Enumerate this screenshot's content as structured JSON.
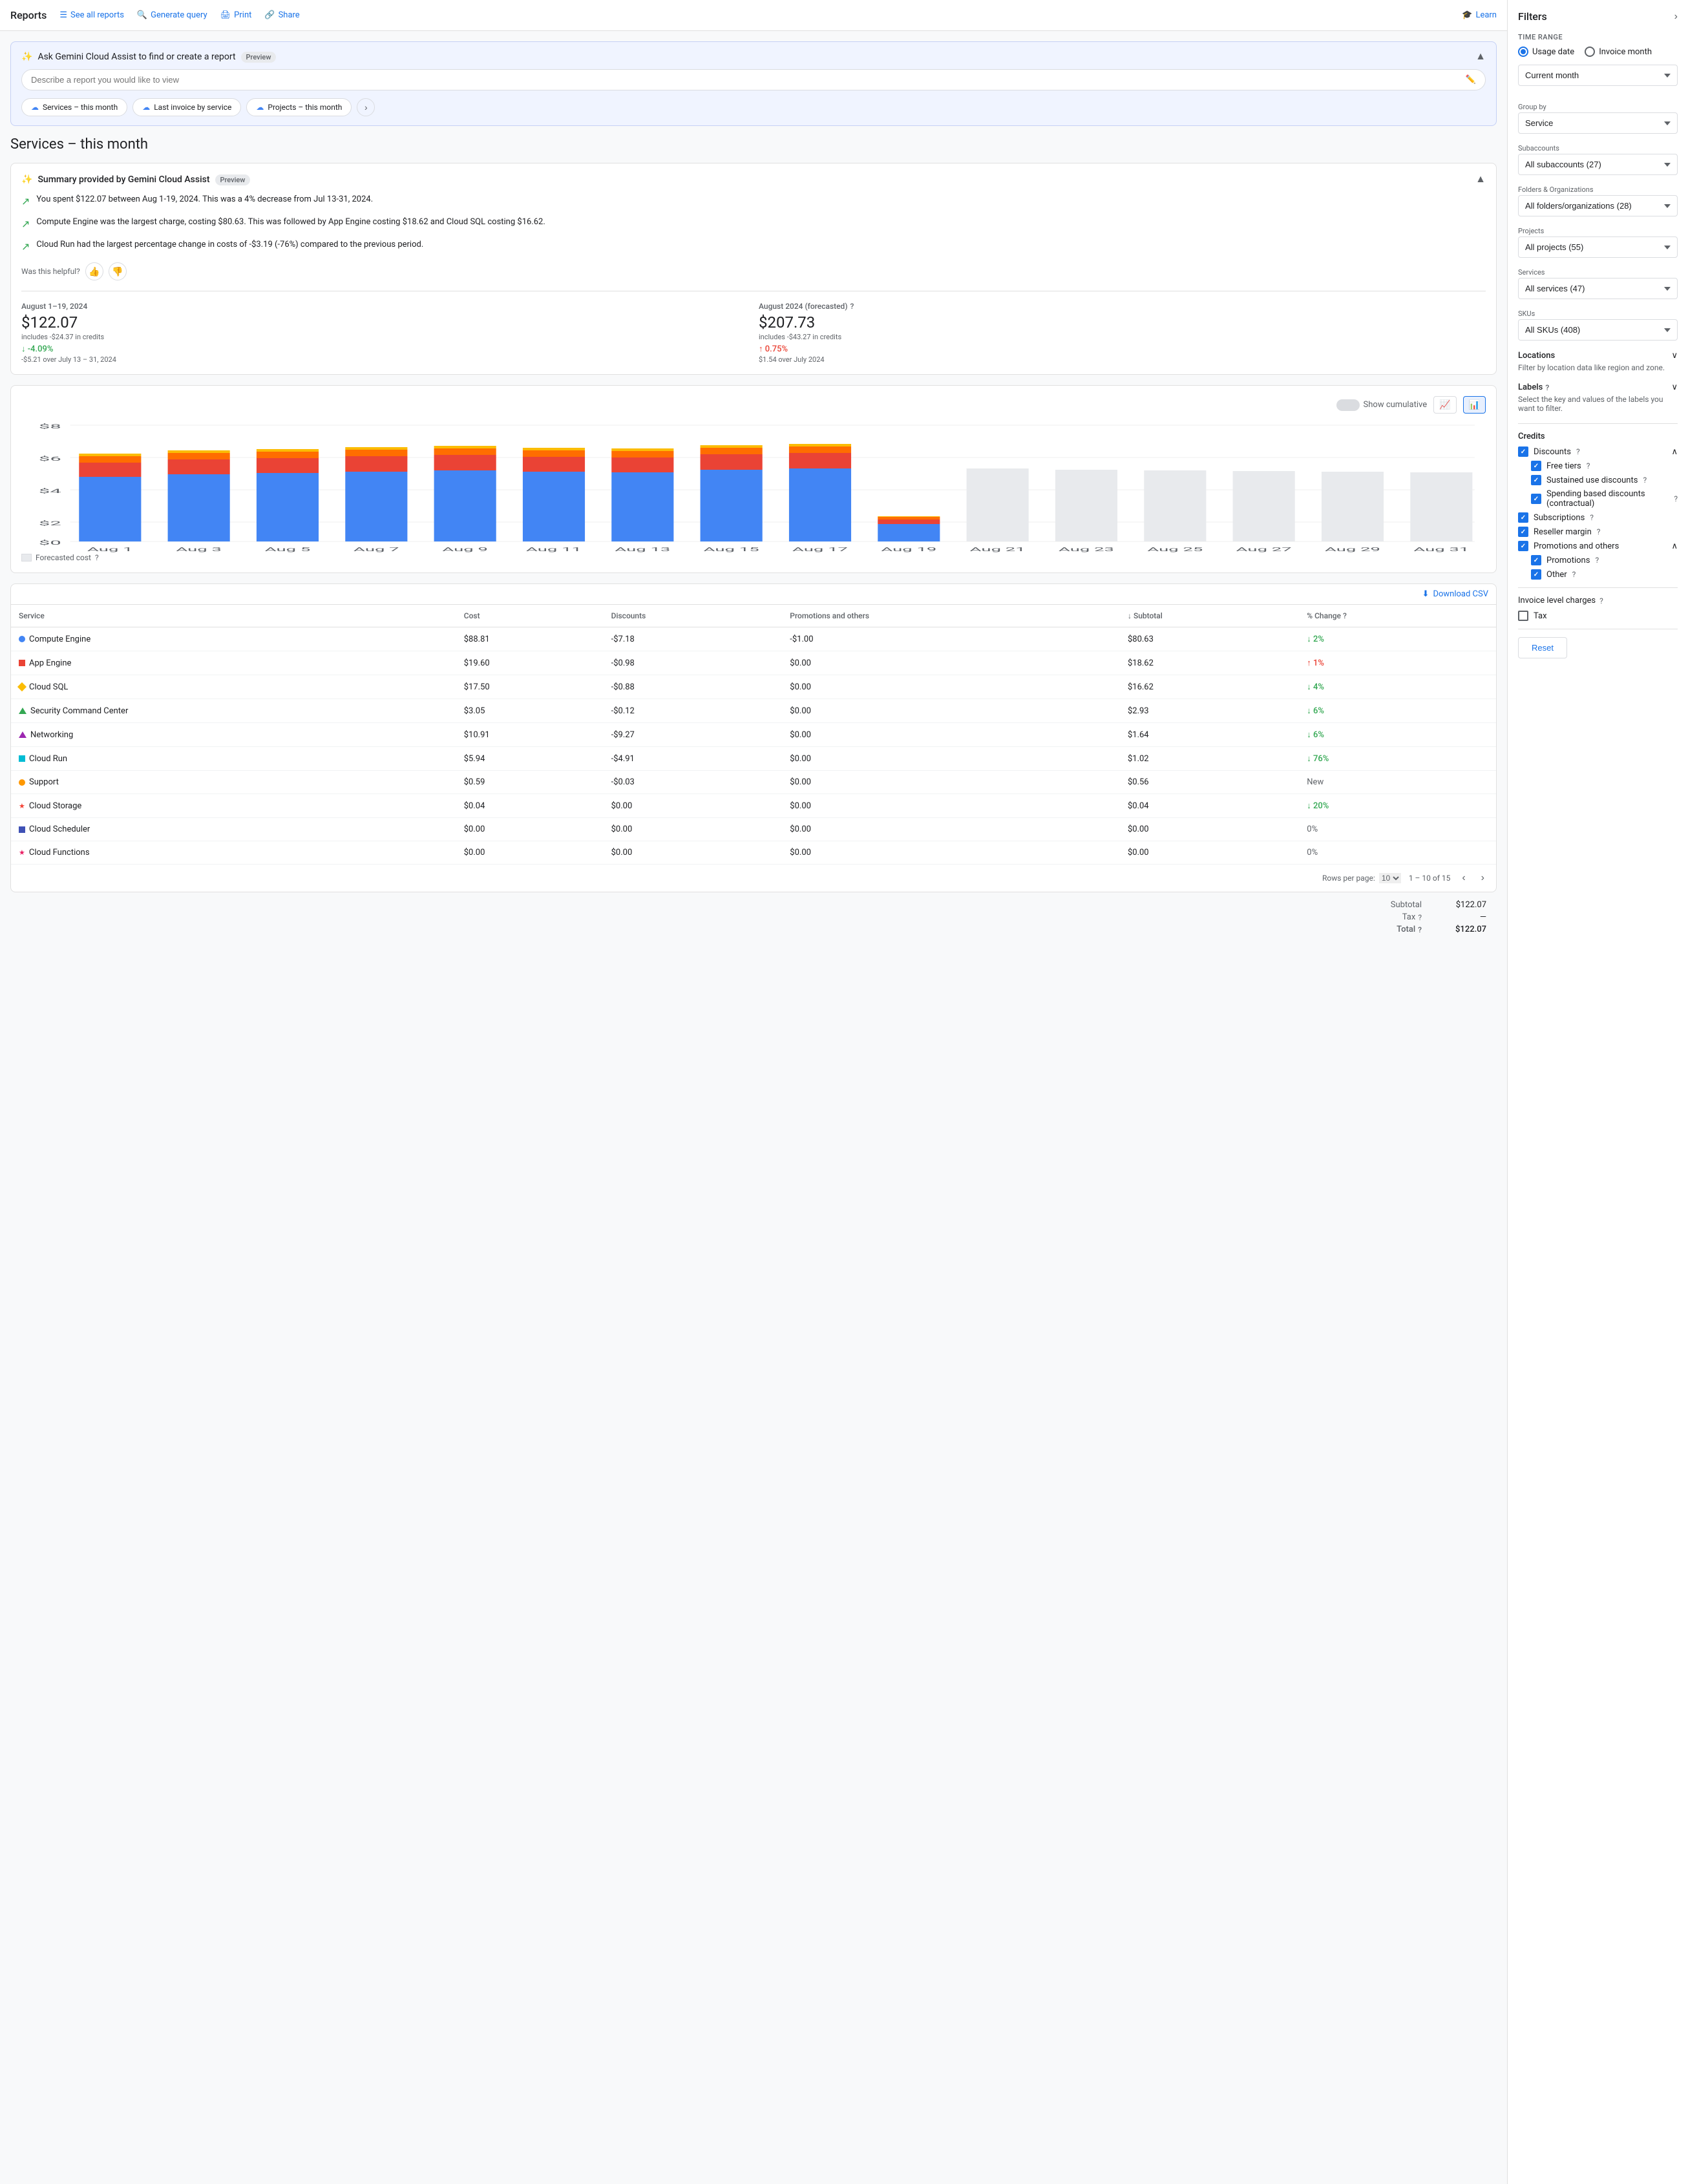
{
  "nav": {
    "brand": "Reports",
    "see_all": "See all reports",
    "generate_query": "Generate query",
    "print": "Print",
    "share": "Share",
    "learn": "Learn"
  },
  "gemini": {
    "title": "Ask Gemini Cloud Assist to find or create a report",
    "preview_badge": "Preview",
    "placeholder": "Describe a report you would like to view",
    "chips": [
      {
        "label": "Services – this month",
        "id": "chip-services"
      },
      {
        "label": "Last invoice by service",
        "id": "chip-last-invoice"
      },
      {
        "label": "Projects – this month",
        "id": "chip-projects"
      }
    ]
  },
  "page_title": "Services – this month",
  "summary": {
    "title": "Summary provided by Gemini Cloud Assist",
    "preview_badge": "Preview",
    "items": [
      "You spent $122.07 between Aug 1-19, 2024. This was a 4% decrease from Jul 13-31, 2024.",
      "Compute Engine was the largest charge, costing $80.63. This was followed by App Engine costing $18.62 and Cloud SQL costing $16.62.",
      "Cloud Run had the largest percentage change in costs of -$3.19 (-76%) compared to the previous period."
    ],
    "feedback_label": "Was this helpful?"
  },
  "metrics": {
    "current": {
      "period": "August 1–19, 2024",
      "value": "$122.07",
      "sub": "includes -$24.37 in credits",
      "change": "-4.09%",
      "change_type": "decrease",
      "change_detail": "-$5.21 over July 13 – 31, 2024"
    },
    "forecasted": {
      "period": "August 2024 (forecasted)",
      "value": "$207.73",
      "sub": "includes -$43.27 in credits",
      "change": "0.75%",
      "change_type": "increase",
      "change_detail": "$1.54 over July 2024"
    }
  },
  "chart": {
    "y_labels": [
      "$8",
      "$6",
      "$4",
      "$2",
      "$0"
    ],
    "show_cumulative": "Show cumulative",
    "forecasted_cost": "Forecasted cost",
    "bars": [
      {
        "label": "Aug 1",
        "blue": 75,
        "red": 20,
        "orange": 8,
        "yellow": 3,
        "forecasted": false
      },
      {
        "label": "Aug 3",
        "blue": 78,
        "red": 22,
        "orange": 9,
        "yellow": 3,
        "forecasted": false
      },
      {
        "label": "Aug 5",
        "blue": 80,
        "red": 22,
        "orange": 9,
        "yellow": 4,
        "forecasted": false
      },
      {
        "label": "Aug 7",
        "blue": 82,
        "red": 23,
        "orange": 10,
        "yellow": 4,
        "forecasted": false
      },
      {
        "label": "Aug 9",
        "blue": 84,
        "red": 24,
        "orange": 10,
        "yellow": 4,
        "forecasted": false
      },
      {
        "label": "Aug 11",
        "blue": 83,
        "red": 23,
        "orange": 10,
        "yellow": 3,
        "forecasted": false
      },
      {
        "label": "Aug 13",
        "blue": 82,
        "red": 23,
        "orange": 9,
        "yellow": 3,
        "forecasted": false
      },
      {
        "label": "Aug 15",
        "blue": 85,
        "red": 24,
        "orange": 10,
        "yellow": 4,
        "forecasted": false
      },
      {
        "label": "Aug 17",
        "blue": 86,
        "red": 24,
        "orange": 10,
        "yellow": 4,
        "forecasted": false
      },
      {
        "label": "Aug 19",
        "blue": 20,
        "red": 6,
        "orange": 3,
        "yellow": 1,
        "forecasted": false
      },
      {
        "label": "Aug 21",
        "blue": 0,
        "red": 0,
        "orange": 0,
        "yellow": 0,
        "forecasted": true
      },
      {
        "label": "Aug 23",
        "blue": 0,
        "red": 0,
        "orange": 0,
        "yellow": 0,
        "forecasted": true
      },
      {
        "label": "Aug 25",
        "blue": 0,
        "red": 0,
        "orange": 0,
        "yellow": 0,
        "forecasted": true
      },
      {
        "label": "Aug 27",
        "blue": 0,
        "red": 0,
        "orange": 0,
        "yellow": 0,
        "forecasted": true
      },
      {
        "label": "Aug 29",
        "blue": 0,
        "red": 0,
        "orange": 0,
        "yellow": 0,
        "forecasted": true
      },
      {
        "label": "Aug 31",
        "blue": 0,
        "red": 0,
        "orange": 0,
        "yellow": 0,
        "forecasted": true
      }
    ]
  },
  "table": {
    "download_csv": "Download CSV",
    "columns": [
      "Service",
      "Cost",
      "Discounts",
      "Promotions and others",
      "Subtotal",
      "% Change"
    ],
    "rows": [
      {
        "service": "Compute Engine",
        "color": "#4285f4",
        "shape": "circle",
        "cost": "$88.81",
        "discounts": "-$7.18",
        "promotions": "-$1.00",
        "subtotal": "$80.63",
        "change": "2%",
        "change_type": "decrease"
      },
      {
        "service": "App Engine",
        "color": "#ea4335",
        "shape": "square",
        "cost": "$19.60",
        "discounts": "-$0.98",
        "promotions": "$0.00",
        "subtotal": "$18.62",
        "change": "1%",
        "change_type": "increase"
      },
      {
        "service": "Cloud SQL",
        "color": "#fbbc04",
        "shape": "diamond",
        "cost": "$17.50",
        "discounts": "-$0.88",
        "promotions": "$0.00",
        "subtotal": "$16.62",
        "change": "4%",
        "change_type": "decrease"
      },
      {
        "service": "Security Command Center",
        "color": "#34a853",
        "shape": "triangle",
        "cost": "$3.05",
        "discounts": "-$0.12",
        "promotions": "$0.00",
        "subtotal": "$2.93",
        "change": "6%",
        "change_type": "decrease"
      },
      {
        "service": "Networking",
        "color": "#9c27b0",
        "shape": "triangle",
        "cost": "$10.91",
        "discounts": "-$9.27",
        "promotions": "$0.00",
        "subtotal": "$1.64",
        "change": "6%",
        "change_type": "decrease"
      },
      {
        "service": "Cloud Run",
        "color": "#00bcd4",
        "shape": "square",
        "cost": "$5.94",
        "discounts": "-$4.91",
        "promotions": "$0.00",
        "subtotal": "$1.02",
        "change": "76%",
        "change_type": "decrease"
      },
      {
        "service": "Support",
        "color": "#ff9800",
        "shape": "circle",
        "cost": "$0.59",
        "discounts": "-$0.03",
        "promotions": "$0.00",
        "subtotal": "$0.56",
        "change": "New",
        "change_type": "neutral"
      },
      {
        "service": "Cloud Storage",
        "color": "#f44336",
        "shape": "star",
        "cost": "$0.04",
        "discounts": "$0.00",
        "promotions": "$0.00",
        "subtotal": "$0.04",
        "change": "20%",
        "change_type": "decrease"
      },
      {
        "service": "Cloud Scheduler",
        "color": "#3f51b5",
        "shape": "square",
        "cost": "$0.00",
        "discounts": "$0.00",
        "promotions": "$0.00",
        "subtotal": "$0.00",
        "change": "0%",
        "change_type": "neutral"
      },
      {
        "service": "Cloud Functions",
        "color": "#e91e63",
        "shape": "star",
        "cost": "$0.00",
        "discounts": "$0.00",
        "promotions": "$0.00",
        "subtotal": "$0.00",
        "change": "0%",
        "change_type": "neutral"
      }
    ],
    "pagination": {
      "rows_per_page": "10",
      "range": "1 – 10 of 15"
    }
  },
  "totals": {
    "subtotal_label": "Subtotal",
    "subtotal_value": "$122.07",
    "tax_label": "Tax",
    "tax_value": "—",
    "total_label": "Total",
    "total_value": "$122.07"
  },
  "filters": {
    "title": "Filters",
    "time_range_label": "Time range",
    "usage_date_label": "Usage date",
    "invoice_month_label": "Invoice month",
    "current_month_label": "Current month",
    "group_by_label": "Group by",
    "group_by_value": "Service",
    "subaccounts_label": "Subaccounts",
    "subaccounts_value": "All subaccounts (27)",
    "folders_label": "Folders & Organizations",
    "folders_value": "All folders/organizations (28)",
    "projects_label": "Projects",
    "projects_value": "All projects (55)",
    "services_label": "Services",
    "services_value": "All services (47)",
    "skus_label": "SKUs",
    "skus_value": "All SKUs (408)",
    "locations_label": "Locations",
    "locations_sub": "Filter by location data like region and zone.",
    "labels_label": "Labels",
    "labels_sub": "Select the key and values of the labels you want to filter.",
    "credits": {
      "title": "Credits",
      "discounts": "Discounts",
      "free_tiers": "Free tiers",
      "sustained_use": "Sustained use discounts",
      "spending_based": "Spending based discounts (contractual)",
      "subscriptions": "Subscriptions",
      "reseller_margin": "Reseller margin",
      "promotions_others": "Promotions and others",
      "promotions": "Promotions",
      "other": "Other"
    },
    "invoice_charges_label": "Invoice level charges",
    "tax_label": "Tax",
    "reset_label": "Reset"
  }
}
